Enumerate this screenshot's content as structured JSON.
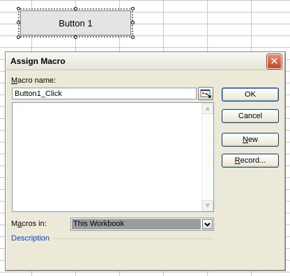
{
  "worksheet": {
    "form_button_label": "Button 1"
  },
  "dialog": {
    "title": "Assign Macro",
    "close_glyph": "✕",
    "macro_name_label_accel": "M",
    "macro_name_label_rest": "acro name:",
    "macro_name_value": "Button1_Click",
    "macro_list_items": [],
    "buttons": {
      "ok": "OK",
      "cancel": "Cancel",
      "new_accel": "N",
      "new_rest": "ew",
      "record_accel": "R",
      "record_rest": "ecord..."
    },
    "macros_in_label_pre": "M",
    "macros_in_label_accel": "a",
    "macros_in_label_rest": "cros in:",
    "macros_in_value": "This Workbook",
    "description_label": "Description"
  },
  "icons": {
    "collapse": "collapse-dialog-icon",
    "scroll_up": "scroll-up-arrow-icon",
    "scroll_down": "scroll-down-arrow-icon",
    "dropdown": "chevron-down-icon"
  }
}
